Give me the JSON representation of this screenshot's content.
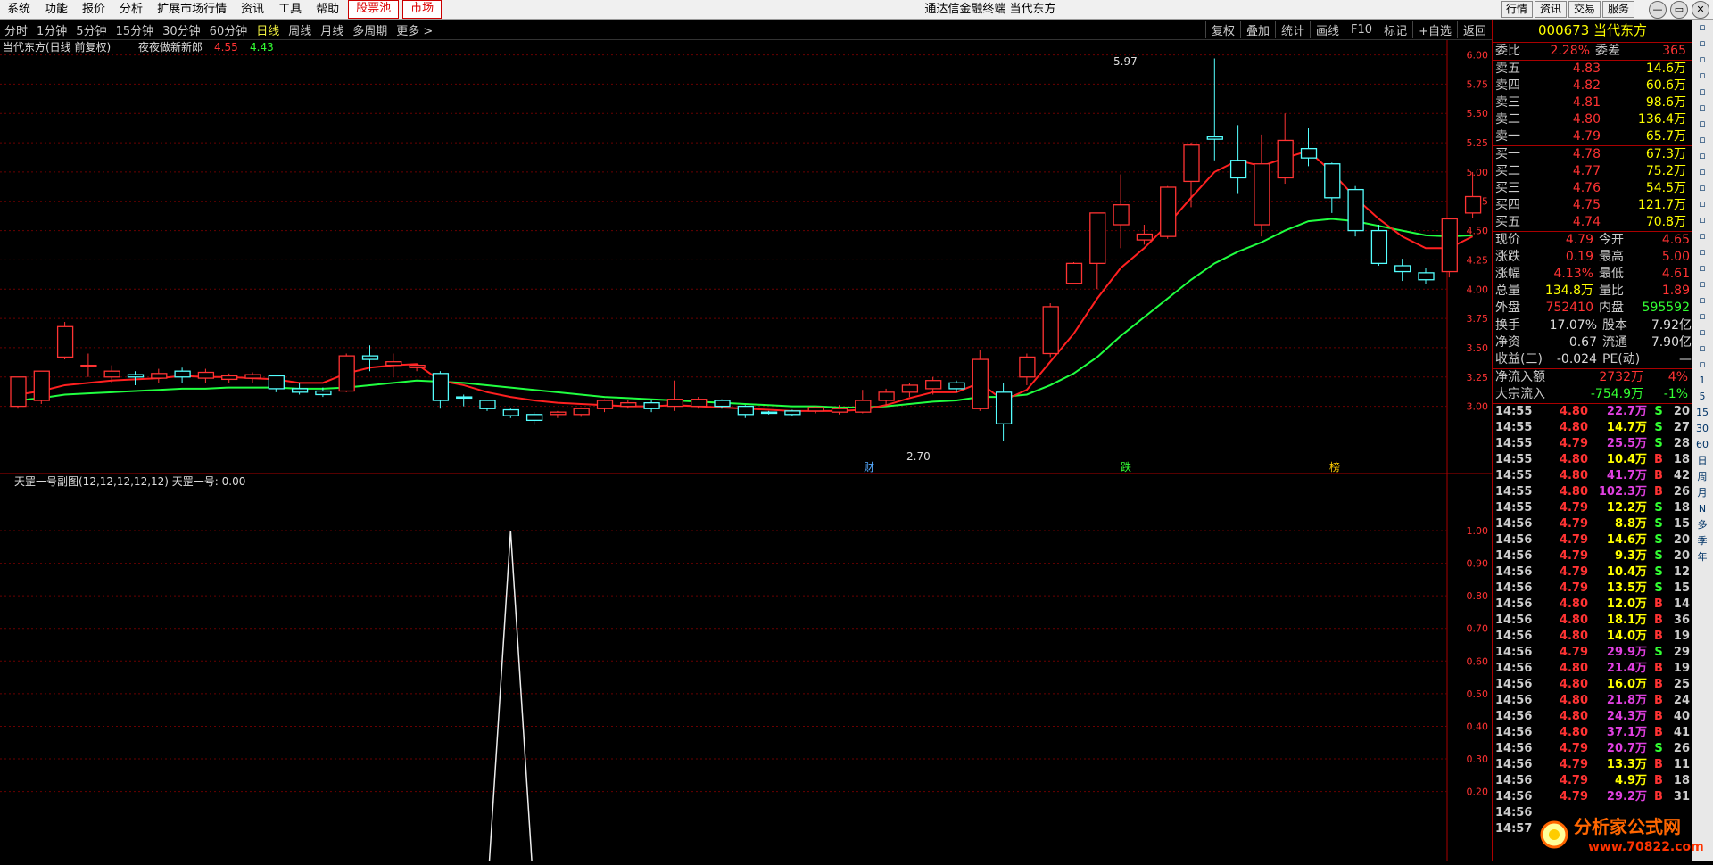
{
  "menu": [
    "系统",
    "功能",
    "报价",
    "分析",
    "扩展市场行情",
    "资讯",
    "工具",
    "帮助"
  ],
  "menu_hl": [
    "股票池",
    "市场"
  ],
  "window_title": "通达信金融终端  当代东方",
  "top_buttons": [
    "行情",
    "资讯",
    "交易",
    "服务"
  ],
  "periods": [
    "分时",
    "1分钟",
    "5分钟",
    "15分钟",
    "30分钟",
    "60分钟",
    "日线",
    "周线",
    "月线",
    "多周期",
    "更多 >"
  ],
  "tool_right": [
    "复权",
    "叠加",
    "统计",
    "画线",
    "F10",
    "标记",
    "+自选",
    "返回"
  ],
  "main_title": "当代东方(日线 前复权)",
  "indicator_name": "夜夜做新新郎",
  "indicator_vals": [
    "4.55",
    "4.43"
  ],
  "sub_title": "天罡一号副图(12,12,12,12,12)  天罡一号: 0.00",
  "price_axis": [
    "6.00",
    "5.75",
    "5.50",
    "5.25",
    "5.00",
    "4.75",
    "4.50",
    "4.25",
    "4.00",
    "3.75",
    "3.50",
    "3.25",
    "3.00"
  ],
  "sub_axis": [
    "1.00",
    "0.90",
    "0.80",
    "0.70",
    "0.60",
    "0.50",
    "0.40",
    "0.30",
    "0.20"
  ],
  "annotations": {
    "high": "5.97",
    "low": "2.70",
    "tag1": "财",
    "tag2": "跌",
    "tag3": "榜"
  },
  "chart_data": {
    "type": "candlestick",
    "ylim": [
      2.7,
      6.05
    ],
    "candles": [
      [
        3.0,
        3.25,
        2.98,
        3.0
      ],
      [
        3.05,
        3.3,
        3.02,
        3.28
      ],
      [
        3.42,
        3.68,
        3.4,
        3.72
      ],
      [
        3.35,
        3.35,
        3.25,
        3.45
      ],
      [
        3.25,
        3.3,
        3.2,
        3.35
      ],
      [
        3.27,
        3.25,
        3.18,
        3.3
      ],
      [
        3.24,
        3.28,
        3.2,
        3.32
      ],
      [
        3.3,
        3.25,
        3.2,
        3.33
      ],
      [
        3.24,
        3.29,
        3.2,
        3.32
      ],
      [
        3.23,
        3.26,
        3.2,
        3.28
      ],
      [
        3.24,
        3.27,
        3.2,
        3.29
      ],
      [
        3.26,
        3.15,
        3.12,
        3.27
      ],
      [
        3.15,
        3.12,
        3.1,
        3.2
      ],
      [
        3.13,
        3.1,
        3.08,
        3.16
      ],
      [
        3.13,
        3.43,
        3.12,
        3.45
      ],
      [
        3.43,
        3.4,
        3.3,
        3.52
      ],
      [
        3.35,
        3.38,
        3.25,
        3.45
      ],
      [
        3.33,
        3.35,
        3.3,
        3.36
      ],
      [
        3.28,
        3.05,
        2.98,
        3.3
      ],
      [
        3.08,
        3.07,
        3.0,
        3.1
      ],
      [
        3.05,
        2.98,
        2.96,
        3.05
      ],
      [
        2.97,
        2.92,
        2.9,
        2.98
      ],
      [
        2.93,
        2.88,
        2.84,
        2.95
      ],
      [
        2.93,
        2.95,
        2.9,
        2.96
      ],
      [
        2.93,
        2.98,
        2.91,
        2.99
      ],
      [
        2.98,
        3.05,
        2.95,
        3.06
      ],
      [
        3.0,
        3.03,
        2.98,
        3.05
      ],
      [
        3.03,
        2.98,
        2.95,
        3.05
      ],
      [
        3.0,
        3.06,
        2.96,
        3.22
      ],
      [
        3.0,
        3.06,
        2.98,
        3.08
      ],
      [
        3.05,
        3.0,
        2.98,
        3.06
      ],
      [
        3.0,
        2.93,
        2.9,
        3.01
      ],
      [
        2.95,
        2.94,
        2.93,
        2.96
      ],
      [
        2.96,
        2.93,
        2.92,
        2.97
      ],
      [
        2.96,
        2.99,
        2.94,
        3.0
      ],
      [
        2.95,
        2.98,
        2.93,
        3.01
      ],
      [
        2.95,
        3.05,
        2.94,
        3.14
      ],
      [
        3.05,
        3.12,
        3.0,
        3.15
      ],
      [
        3.12,
        3.18,
        3.08,
        3.2
      ],
      [
        3.15,
        3.22,
        3.1,
        3.25
      ],
      [
        3.2,
        3.15,
        3.12,
        3.22
      ],
      [
        2.98,
        3.4,
        2.96,
        3.48
      ],
      [
        3.12,
        2.85,
        2.7,
        3.2
      ],
      [
        3.25,
        3.42,
        3.18,
        3.45
      ],
      [
        3.45,
        3.85,
        3.42,
        3.88
      ],
      [
        4.05,
        4.22,
        4.05,
        4.23
      ],
      [
        4.22,
        4.65,
        4.0,
        4.65
      ],
      [
        4.55,
        4.72,
        4.35,
        4.98
      ],
      [
        4.42,
        4.47,
        4.38,
        4.55
      ],
      [
        4.45,
        4.87,
        4.43,
        4.88
      ],
      [
        4.92,
        5.23,
        4.7,
        5.25
      ],
      [
        5.3,
        5.28,
        5.1,
        5.97
      ],
      [
        5.1,
        4.95,
        4.82,
        5.4
      ],
      [
        4.55,
        5.07,
        4.45,
        5.32
      ],
      [
        4.95,
        5.27,
        4.9,
        5.5
      ],
      [
        5.2,
        5.12,
        5.05,
        5.38
      ],
      [
        5.07,
        4.78,
        4.65,
        5.08
      ],
      [
        4.85,
        4.5,
        4.45,
        4.88
      ],
      [
        4.5,
        4.22,
        4.2,
        4.55
      ],
      [
        4.2,
        4.15,
        4.07,
        4.26
      ],
      [
        4.14,
        4.08,
        4.04,
        4.18
      ],
      [
        4.15,
        4.6,
        4.1,
        4.6
      ],
      [
        4.65,
        4.79,
        4.61,
        5.0
      ]
    ],
    "ma_short": [
      3.1,
      3.13,
      3.18,
      3.2,
      3.22,
      3.23,
      3.24,
      3.26,
      3.25,
      3.25,
      3.24,
      3.23,
      3.2,
      3.2,
      3.28,
      3.33,
      3.35,
      3.36,
      3.22,
      3.18,
      3.12,
      3.08,
      3.05,
      3.03,
      3.02,
      3.01,
      3.0,
      3.0,
      3.01,
      3.0,
      2.99,
      2.98,
      2.97,
      2.96,
      2.96,
      2.96,
      2.97,
      3.01,
      3.07,
      3.12,
      3.12,
      3.2,
      3.05,
      3.14,
      3.38,
      3.62,
      3.92,
      4.18,
      4.35,
      4.55,
      4.78,
      5.0,
      5.1,
      5.05,
      5.12,
      5.18,
      5.0,
      4.78,
      4.6,
      4.45,
      4.35,
      4.35,
      4.45
    ],
    "ma_long": [
      3.05,
      3.07,
      3.1,
      3.11,
      3.12,
      3.13,
      3.14,
      3.15,
      3.15,
      3.16,
      3.16,
      3.16,
      3.15,
      3.15,
      3.16,
      3.18,
      3.2,
      3.22,
      3.21,
      3.2,
      3.18,
      3.16,
      3.14,
      3.12,
      3.1,
      3.08,
      3.07,
      3.06,
      3.05,
      3.04,
      3.03,
      3.02,
      3.01,
      3.0,
      3.0,
      2.99,
      2.99,
      3.0,
      3.02,
      3.04,
      3.05,
      3.08,
      3.08,
      3.1,
      3.18,
      3.28,
      3.42,
      3.6,
      3.76,
      3.92,
      4.08,
      4.22,
      4.32,
      4.4,
      4.5,
      4.58,
      4.6,
      4.58,
      4.54,
      4.5,
      4.46,
      4.45,
      4.46
    ],
    "sub_series": {
      "name": "天罡一号",
      "x_peak": 21,
      "values": [
        0,
        0,
        0,
        0,
        0,
        0,
        0,
        0,
        0,
        0,
        0,
        0,
        0,
        0,
        0,
        0,
        0,
        0,
        0,
        0,
        0,
        1,
        0,
        0,
        0,
        0,
        0,
        0,
        0,
        0,
        0,
        0,
        0,
        0,
        0,
        0,
        0,
        0,
        0,
        0,
        0,
        0,
        0,
        0,
        0,
        0,
        0,
        0,
        0,
        0,
        0,
        0,
        0,
        0,
        0,
        0,
        0,
        0,
        0,
        0,
        0,
        0,
        0
      ]
    }
  },
  "quote": {
    "code_name": "000673 当代东方",
    "weibi": {
      "label1": "委比",
      "v1": "2.28%",
      "label2": "委差",
      "v2": "365"
    },
    "asks": [
      {
        "label": "卖五",
        "price": "4.83",
        "vol": "14.6万"
      },
      {
        "label": "卖四",
        "price": "4.82",
        "vol": "60.6万"
      },
      {
        "label": "卖三",
        "price": "4.81",
        "vol": "98.6万"
      },
      {
        "label": "卖二",
        "price": "4.80",
        "vol": "136.4万"
      },
      {
        "label": "卖一",
        "price": "4.79",
        "vol": "65.7万"
      }
    ],
    "bids": [
      {
        "label": "买一",
        "price": "4.78",
        "vol": "67.3万"
      },
      {
        "label": "买二",
        "price": "4.77",
        "vol": "75.2万"
      },
      {
        "label": "买三",
        "price": "4.76",
        "vol": "54.5万"
      },
      {
        "label": "买四",
        "price": "4.75",
        "vol": "121.7万"
      },
      {
        "label": "买五",
        "price": "4.74",
        "vol": "70.8万"
      }
    ],
    "stats": [
      [
        "现价",
        "4.79",
        "今开",
        "4.65"
      ],
      [
        "涨跌",
        "0.19",
        "最高",
        "5.00"
      ],
      [
        "涨幅",
        "4.13%",
        "最低",
        "4.61"
      ],
      [
        "总量",
        "134.8万",
        "量比",
        "1.89"
      ],
      [
        "外盘",
        "752410",
        "内盘",
        "595592"
      ]
    ],
    "stats2": [
      [
        "换手",
        "17.07%",
        "股本",
        "7.92亿"
      ],
      [
        "净资",
        "0.67",
        "流通",
        "7.90亿"
      ],
      [
        "收益(三)",
        "-0.024",
        "PE(动)",
        "—"
      ]
    ],
    "flow": [
      [
        "净流入额",
        "2732万",
        "4%"
      ],
      [
        "大宗流入",
        "-754.9万",
        "-1%"
      ]
    ],
    "ticks": [
      [
        "14:55",
        "4.80",
        "22.7万",
        "S",
        "20"
      ],
      [
        "14:55",
        "4.80",
        "14.7万",
        "S",
        "27"
      ],
      [
        "14:55",
        "4.79",
        "25.5万",
        "S",
        "28"
      ],
      [
        "14:55",
        "4.80",
        "10.4万",
        "B",
        "18"
      ],
      [
        "14:55",
        "4.80",
        "41.7万",
        "B",
        "42"
      ],
      [
        "14:55",
        "4.80",
        "102.3万",
        "B",
        "26"
      ],
      [
        "14:55",
        "4.79",
        "12.2万",
        "S",
        "18"
      ],
      [
        "14:56",
        "4.79",
        "8.8万",
        "S",
        "15"
      ],
      [
        "14:56",
        "4.79",
        "14.6万",
        "S",
        "20"
      ],
      [
        "14:56",
        "4.79",
        "9.3万",
        "S",
        "20"
      ],
      [
        "14:56",
        "4.79",
        "10.4万",
        "S",
        "12"
      ],
      [
        "14:56",
        "4.79",
        "13.5万",
        "S",
        "15"
      ],
      [
        "14:56",
        "4.80",
        "12.0万",
        "B",
        "14"
      ],
      [
        "14:56",
        "4.80",
        "18.1万",
        "B",
        "36"
      ],
      [
        "14:56",
        "4.80",
        "14.0万",
        "B",
        "19"
      ],
      [
        "14:56",
        "4.79",
        "29.9万",
        "S",
        "29"
      ],
      [
        "14:56",
        "4.80",
        "21.4万",
        "B",
        "19"
      ],
      [
        "14:56",
        "4.80",
        "16.0万",
        "B",
        "25"
      ],
      [
        "14:56",
        "4.80",
        "21.8万",
        "B",
        "24"
      ],
      [
        "14:56",
        "4.80",
        "24.3万",
        "B",
        "40"
      ],
      [
        "14:56",
        "4.80",
        "37.1万",
        "B",
        "41"
      ],
      [
        "14:56",
        "4.79",
        "20.7万",
        "S",
        "26"
      ],
      [
        "14:56",
        "4.79",
        "13.3万",
        "B",
        "11"
      ],
      [
        "14:56",
        "4.79",
        "4.9万",
        "B",
        "18"
      ],
      [
        "14:56",
        "4.79",
        "29.2万",
        "B",
        "31"
      ],
      [
        "14:56",
        "",
        "",
        "",
        ""
      ],
      [
        "14:57",
        "",
        "",
        "",
        ""
      ]
    ]
  },
  "sidebar_labels": [
    "1",
    "5",
    "15",
    "30",
    "60",
    "日",
    "周",
    "月",
    "N",
    "多",
    "季",
    "年"
  ],
  "logo_text": {
    "name": "分析家公式网",
    "url": "www.70822.com"
  },
  "colors": {
    "up": "#ff3333",
    "down": "#54ffff",
    "ma_short": "#ff2020",
    "ma_long": "#20ff40",
    "grid": "#6a0000"
  }
}
